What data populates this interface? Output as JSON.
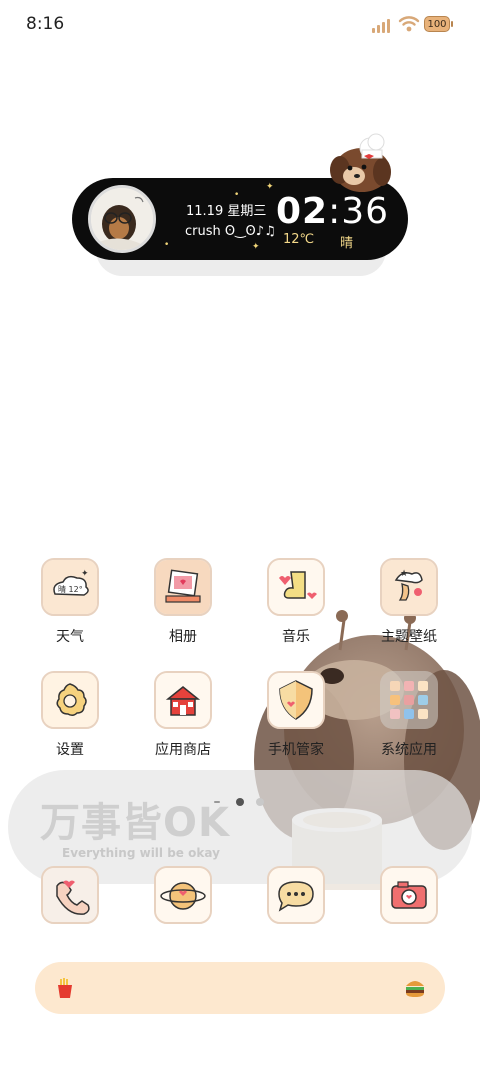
{
  "status_bar": {
    "time": "8:16",
    "battery": "100"
  },
  "widget": {
    "date": "11.19 星期三",
    "crush_text": "crush ʘ‿ʘ♪♫",
    "clock_hour": "02",
    "clock_min": ":36",
    "temperature": "12℃",
    "weather": "晴"
  },
  "apps": [
    {
      "label": "天气",
      "icon": "weather-icon",
      "icon_text": "晴 12°"
    },
    {
      "label": "相册",
      "icon": "album-icon"
    },
    {
      "label": "音乐",
      "icon": "music-icon"
    },
    {
      "label": "主题壁纸",
      "icon": "theme-wallpaper-icon"
    },
    {
      "label": "设置",
      "icon": "settings-icon"
    },
    {
      "label": "应用商店",
      "icon": "app-store-icon"
    },
    {
      "label": "手机管家",
      "icon": "phone-manager-icon"
    },
    {
      "label": "系统应用",
      "icon": "system-apps-folder-icon"
    }
  ],
  "banner": {
    "title": "万事皆OK",
    "subtitle": "Everything will be okay",
    "page_dots": 3,
    "active_dot": 1
  },
  "bottom_row_icons": [
    "phone-icon",
    "browser-icon",
    "messages-icon",
    "camera-icon"
  ],
  "dock": {
    "left_icon": "fries-icon",
    "right_icon": "burger-icon",
    "color": "#fde8cf"
  },
  "colors": {
    "accent": "#e8b27a",
    "widget_bg": "#0c0c0c",
    "icon_border": "#e8d2c0"
  }
}
